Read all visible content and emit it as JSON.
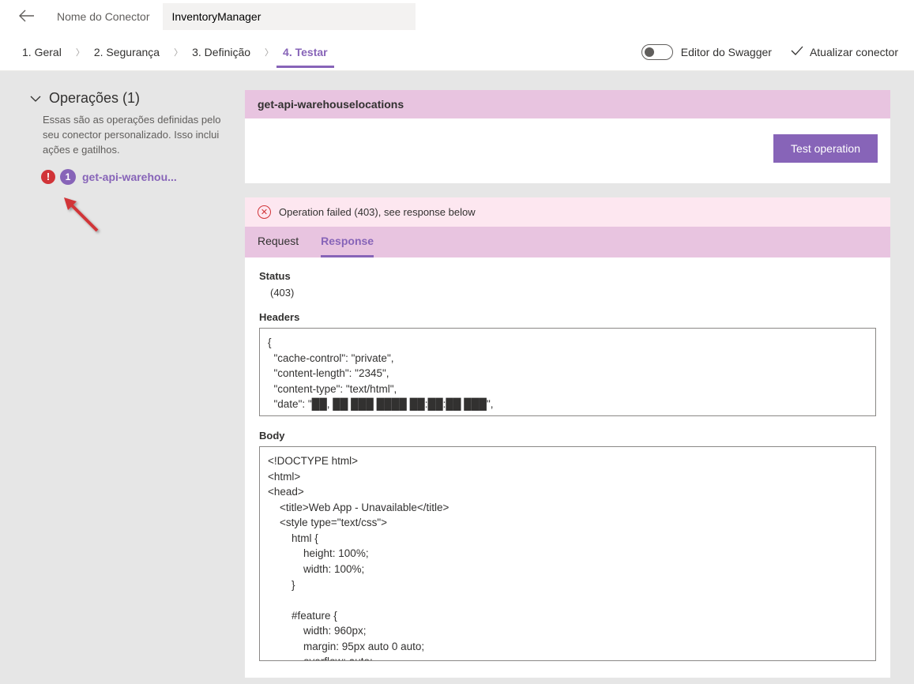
{
  "header": {
    "connector_label": "Nome do Conector",
    "connector_name": "InventoryManager"
  },
  "tabs": {
    "general": "1. Geral",
    "security": "2. Segurança",
    "definition": "3. Definição",
    "test": "4. Testar",
    "swagger_toggle": "Editor do Swagger",
    "update": "Atualizar conector"
  },
  "sidebar": {
    "ops_title": "Operações (1)",
    "ops_desc": "Essas são as operações definidas pelo seu conector personalizado. Isso inclui ações e gatilhos.",
    "alert": "!",
    "count": "1",
    "op_name": "get-api-warehou..."
  },
  "main": {
    "op_title": "get-api-warehouselocations",
    "test_btn": "Test operation",
    "error_msg": "Operation failed (403), see response below",
    "tab_request": "Request",
    "tab_response": "Response",
    "status_label": "Status",
    "status_value": "(403)",
    "headers_label": "Headers",
    "headers_value": "{\n  \"cache-control\": \"private\",\n  \"content-length\": \"2345\",\n  \"content-type\": \"text/html\",\n  \"date\": \"██, ██ ███ ████ ██:██:██ ███\",\n  \"x-ms-apihub-cached-response\": \"true\"",
    "body_label": "Body",
    "body_value": "<!DOCTYPE html>\n<html>\n<head>\n    <title>Web App - Unavailable</title>\n    <style type=\"text/css\">\n        html {\n            height: 100%;\n            width: 100%;\n        }\n\n        #feature {\n            width: 960px;\n            margin: 95px auto 0 auto;\n            overflow: auto;"
  }
}
